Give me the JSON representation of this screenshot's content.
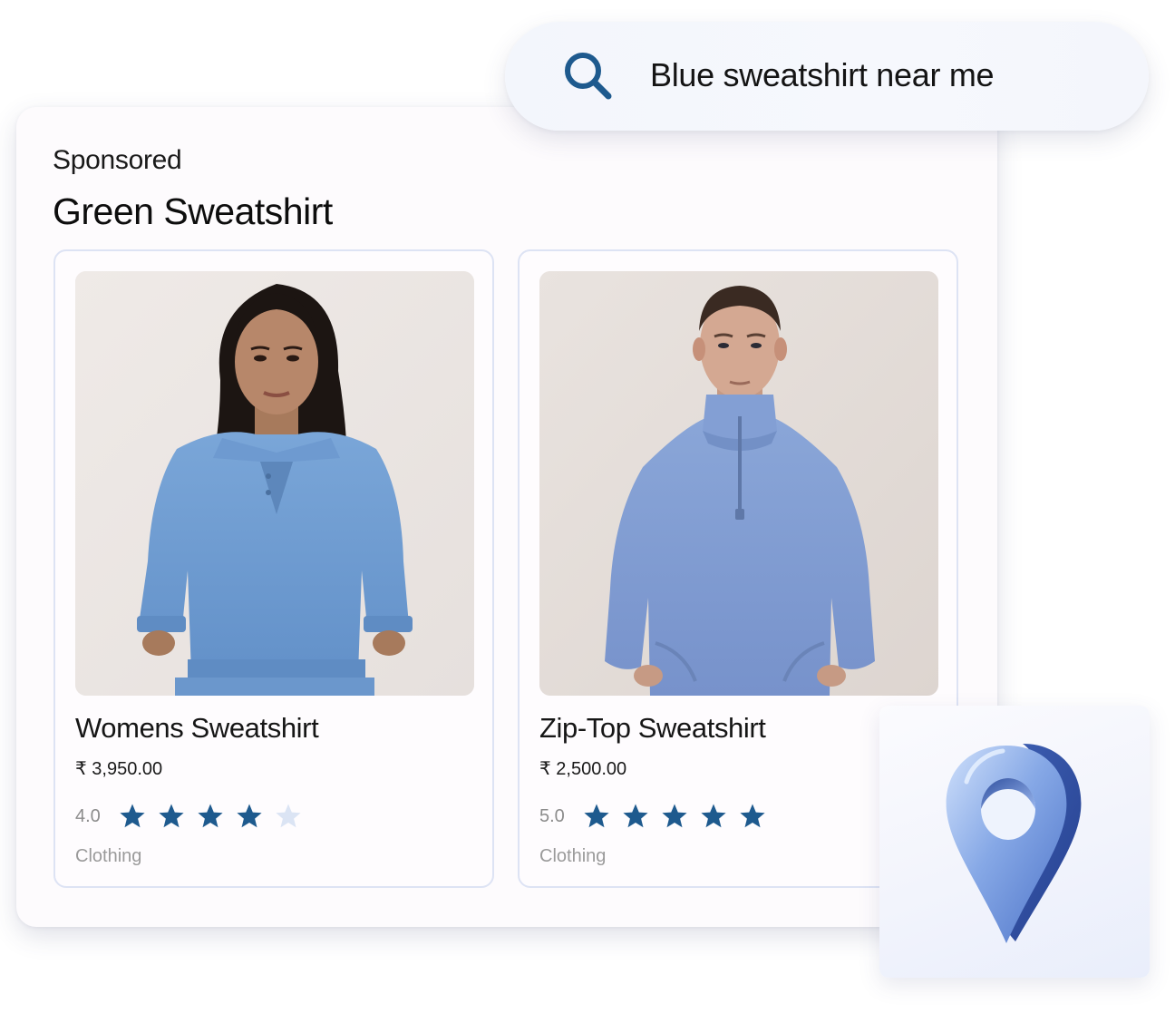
{
  "search": {
    "query": "Blue sweatshirt near me",
    "icon": "search-icon",
    "icon_color": "#1e5a8e"
  },
  "ad": {
    "sponsored_label": "Sponsored",
    "title": "Green Sweatshirt"
  },
  "products": [
    {
      "name": "Womens Sweatshirt",
      "price": "₹ 3,950.00",
      "rating_text": "4.0",
      "rating": 4,
      "max_rating": 5,
      "category": "Clothing",
      "image": "woman-in-blue-polo-sweatshirt"
    },
    {
      "name": "Zip-Top Sweatshirt",
      "price": "₹ 2,500.00",
      "rating_text": "5.0",
      "rating": 5,
      "max_rating": 5,
      "category": "Clothing",
      "image": "man-in-blue-zip-top-sweatshirt"
    }
  ],
  "location": {
    "icon": "map-pin-icon"
  },
  "colors": {
    "star_filled": "#1e5a8e",
    "star_empty": "#dbe4f4",
    "sweatshirt_blue": "#6f9bd0",
    "card_border": "#dde3f4"
  }
}
